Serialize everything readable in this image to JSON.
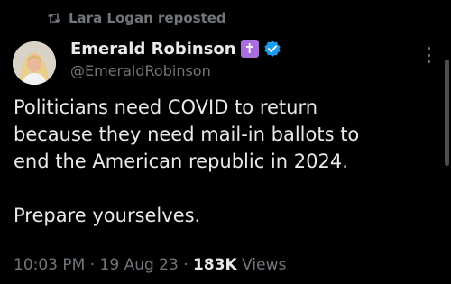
{
  "repost": {
    "label": "Lara Logan reposted",
    "icon": "repost-icon"
  },
  "author": {
    "display_name": "Emerald Robinson",
    "badge_glyph": "✝",
    "badge_color": "#a86ee0",
    "verified_color": "#1d9bf0",
    "handle": "@EmeraldRobinson"
  },
  "tweet": {
    "lines": [
      "Politicians need COVID to return",
      "because they need mail-in ballots to",
      "end the American republic in 2024."
    ],
    "closing": "Prepare yourselves."
  },
  "meta": {
    "time": "10:03 PM",
    "separator": "·",
    "date": "19 Aug 23",
    "view_count": "183K",
    "views_label": "Views"
  },
  "colors": {
    "background": "#000000",
    "text": "#e7e9ea",
    "muted": "#71767b"
  }
}
